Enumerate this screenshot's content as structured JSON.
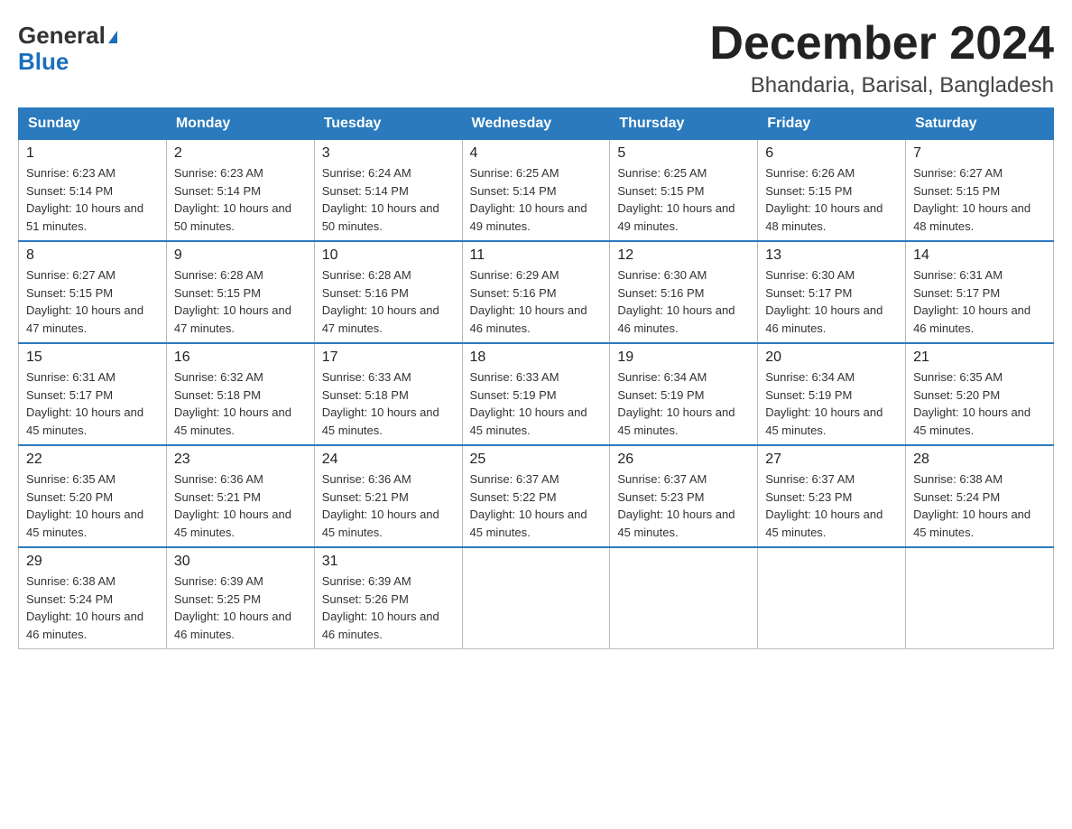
{
  "header": {
    "logo_general": "General",
    "logo_blue": "Blue",
    "month_title": "December 2024",
    "location": "Bhandaria, Barisal, Bangladesh"
  },
  "weekdays": [
    "Sunday",
    "Monday",
    "Tuesday",
    "Wednesday",
    "Thursday",
    "Friday",
    "Saturday"
  ],
  "weeks": [
    [
      {
        "day": "1",
        "sunrise": "6:23 AM",
        "sunset": "5:14 PM",
        "daylight": "10 hours and 51 minutes."
      },
      {
        "day": "2",
        "sunrise": "6:23 AM",
        "sunset": "5:14 PM",
        "daylight": "10 hours and 50 minutes."
      },
      {
        "day": "3",
        "sunrise": "6:24 AM",
        "sunset": "5:14 PM",
        "daylight": "10 hours and 50 minutes."
      },
      {
        "day": "4",
        "sunrise": "6:25 AM",
        "sunset": "5:14 PM",
        "daylight": "10 hours and 49 minutes."
      },
      {
        "day": "5",
        "sunrise": "6:25 AM",
        "sunset": "5:15 PM",
        "daylight": "10 hours and 49 minutes."
      },
      {
        "day": "6",
        "sunrise": "6:26 AM",
        "sunset": "5:15 PM",
        "daylight": "10 hours and 48 minutes."
      },
      {
        "day": "7",
        "sunrise": "6:27 AM",
        "sunset": "5:15 PM",
        "daylight": "10 hours and 48 minutes."
      }
    ],
    [
      {
        "day": "8",
        "sunrise": "6:27 AM",
        "sunset": "5:15 PM",
        "daylight": "10 hours and 47 minutes."
      },
      {
        "day": "9",
        "sunrise": "6:28 AM",
        "sunset": "5:15 PM",
        "daylight": "10 hours and 47 minutes."
      },
      {
        "day": "10",
        "sunrise": "6:28 AM",
        "sunset": "5:16 PM",
        "daylight": "10 hours and 47 minutes."
      },
      {
        "day": "11",
        "sunrise": "6:29 AM",
        "sunset": "5:16 PM",
        "daylight": "10 hours and 46 minutes."
      },
      {
        "day": "12",
        "sunrise": "6:30 AM",
        "sunset": "5:16 PM",
        "daylight": "10 hours and 46 minutes."
      },
      {
        "day": "13",
        "sunrise": "6:30 AM",
        "sunset": "5:17 PM",
        "daylight": "10 hours and 46 minutes."
      },
      {
        "day": "14",
        "sunrise": "6:31 AM",
        "sunset": "5:17 PM",
        "daylight": "10 hours and 46 minutes."
      }
    ],
    [
      {
        "day": "15",
        "sunrise": "6:31 AM",
        "sunset": "5:17 PM",
        "daylight": "10 hours and 45 minutes."
      },
      {
        "day": "16",
        "sunrise": "6:32 AM",
        "sunset": "5:18 PM",
        "daylight": "10 hours and 45 minutes."
      },
      {
        "day": "17",
        "sunrise": "6:33 AM",
        "sunset": "5:18 PM",
        "daylight": "10 hours and 45 minutes."
      },
      {
        "day": "18",
        "sunrise": "6:33 AM",
        "sunset": "5:19 PM",
        "daylight": "10 hours and 45 minutes."
      },
      {
        "day": "19",
        "sunrise": "6:34 AM",
        "sunset": "5:19 PM",
        "daylight": "10 hours and 45 minutes."
      },
      {
        "day": "20",
        "sunrise": "6:34 AM",
        "sunset": "5:19 PM",
        "daylight": "10 hours and 45 minutes."
      },
      {
        "day": "21",
        "sunrise": "6:35 AM",
        "sunset": "5:20 PM",
        "daylight": "10 hours and 45 minutes."
      }
    ],
    [
      {
        "day": "22",
        "sunrise": "6:35 AM",
        "sunset": "5:20 PM",
        "daylight": "10 hours and 45 minutes."
      },
      {
        "day": "23",
        "sunrise": "6:36 AM",
        "sunset": "5:21 PM",
        "daylight": "10 hours and 45 minutes."
      },
      {
        "day": "24",
        "sunrise": "6:36 AM",
        "sunset": "5:21 PM",
        "daylight": "10 hours and 45 minutes."
      },
      {
        "day": "25",
        "sunrise": "6:37 AM",
        "sunset": "5:22 PM",
        "daylight": "10 hours and 45 minutes."
      },
      {
        "day": "26",
        "sunrise": "6:37 AM",
        "sunset": "5:23 PM",
        "daylight": "10 hours and 45 minutes."
      },
      {
        "day": "27",
        "sunrise": "6:37 AM",
        "sunset": "5:23 PM",
        "daylight": "10 hours and 45 minutes."
      },
      {
        "day": "28",
        "sunrise": "6:38 AM",
        "sunset": "5:24 PM",
        "daylight": "10 hours and 45 minutes."
      }
    ],
    [
      {
        "day": "29",
        "sunrise": "6:38 AM",
        "sunset": "5:24 PM",
        "daylight": "10 hours and 46 minutes."
      },
      {
        "day": "30",
        "sunrise": "6:39 AM",
        "sunset": "5:25 PM",
        "daylight": "10 hours and 46 minutes."
      },
      {
        "day": "31",
        "sunrise": "6:39 AM",
        "sunset": "5:26 PM",
        "daylight": "10 hours and 46 minutes."
      },
      null,
      null,
      null,
      null
    ]
  ]
}
